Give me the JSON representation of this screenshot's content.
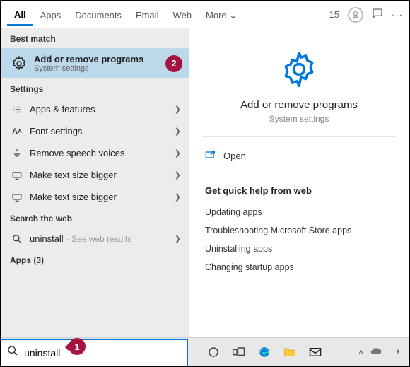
{
  "tabs": {
    "items": [
      "All",
      "Apps",
      "Documents",
      "Email",
      "Web",
      "More"
    ],
    "more_glyph": "⌄",
    "active_index": 0,
    "rewards_count": "15"
  },
  "left": {
    "best_match_header": "Best match",
    "best_match": {
      "title": "Add or remove programs",
      "subtitle": "System settings"
    },
    "step_badge_2": "2",
    "settings_header": "Settings",
    "settings": [
      {
        "icon": "list",
        "label": "Apps & features"
      },
      {
        "icon": "font",
        "label": "Font settings"
      },
      {
        "icon": "mic",
        "label": "Remove speech voices"
      },
      {
        "icon": "screen",
        "label": "Make text size bigger"
      },
      {
        "icon": "screen",
        "label": "Make text size bigger"
      }
    ],
    "search_web_header": "Search the web",
    "web_item": {
      "query": "uninstall",
      "suffix": "- See web results"
    },
    "apps_header": "Apps (3)"
  },
  "right": {
    "title": "Add or remove programs",
    "subtitle": "System settings",
    "open_label": "Open",
    "quick_help_header": "Get quick help from web",
    "quick_help": [
      "Updating apps",
      "Troubleshooting Microsoft Store apps",
      "Uninstalling apps",
      "Changing startup apps"
    ]
  },
  "search": {
    "value": "uninstall",
    "step_badge_1": "1"
  },
  "colors": {
    "accent": "#0078d7",
    "badge": "#a6133f"
  }
}
